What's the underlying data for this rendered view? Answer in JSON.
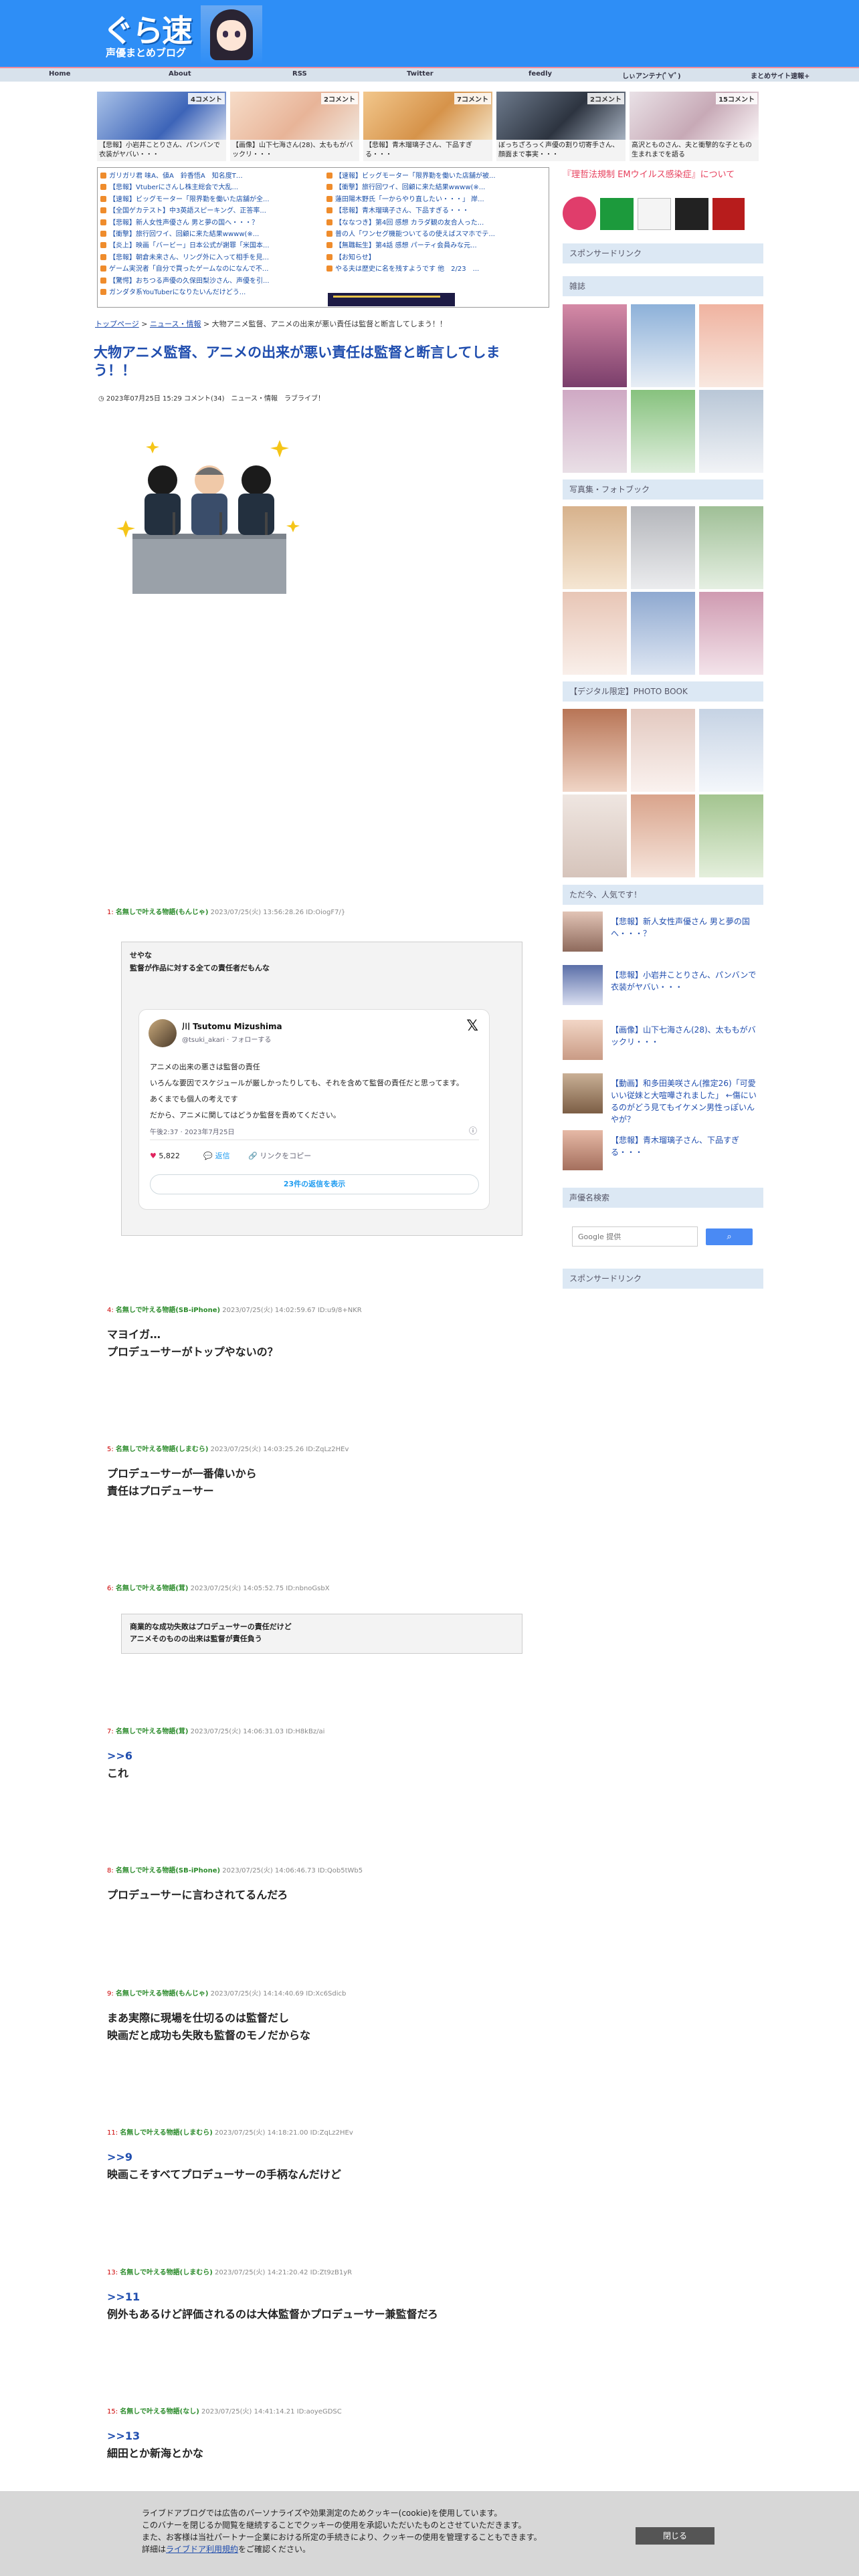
{
  "site": {
    "logo_main": "ぐら速",
    "logo_sub": "声優まとめブログ"
  },
  "nav": [
    "Home",
    "About",
    "RSS",
    "Twitter",
    "feedly",
    "しぃアンテナ(ﾟ∀ﾟ)",
    "まとめサイト速報+"
  ],
  "feature_cards": [
    {
      "comments": "4コメント",
      "caption": "【悲報】小岩井ことりさん、パンバンで衣装がヤバい・・・"
    },
    {
      "comments": "2コメント",
      "caption": "【画像】山下七海さん(28)、太ももがバックリ・・・"
    },
    {
      "comments": "7コメント",
      "caption": "【悲報】青木瑠璃子さん、下品すぎる・・・"
    },
    {
      "comments": "2コメント",
      "caption": "ぼっちざろっく声優の割り切寄手さん、顔面まで事実・・・"
    },
    {
      "comments": "15コメント",
      "caption": "高沢とものさん、夫と衝撃的な子ともの生まれまでを語る"
    }
  ],
  "links_left": [
    "ガリガリ君 味A、値A　鈴香悟A　知名度T…",
    "【悲報】Vtuberにさんし株主総会で大乱...",
    "【速報】ビッグモーター「限界勤を働いた店舗が全...",
    "【全国ゲカテスト】中3英語スピーキング、正答率...",
    "【悲報】新人女性声優さん 男と夢の国へ・・・？",
    "【衝撃】旅行回ワイ、回顧に来た結果wwww(※...",
    "【炎上】映画「バービー」日本公式が謝罪「米国本...",
    "【悲報】朝倉未来さん、リング外に入って相手を見...",
    "ゲーム実況者「自分で買ったゲームなのになんで不...",
    "【驚愕】おちつる声優の久保田梨沙さん、声優を引...",
    "ガンダタ系YouTuberになりたいんだけどう..."
  ],
  "links_right": [
    "【速報】ビッグモーター「限界勤を働いた店舗が被...",
    "【衝撃】旅行回ワイ、回顧に来た結果wwww(※...",
    "蓮田陽木野氏「一からやり直したい・・・」 岸...",
    "【悲報】青木瑠璃子さん、下品すぎる・・・",
    "【ななつき】第4回 感想 カラダ観の友合人った...",
    "普の人「ワンセグ機能ついてるの使えばスマホでテ...",
    "【無職転生】第4話 感想 パーティ会員みな元...",
    "【お知らせ】",
    "やる夫は歴史に名を残すようです 他　2/23　..."
  ],
  "breadcrumb": {
    "top": "トップページ",
    "cat": "ニュース・情報",
    "current": "> 大物アニメ監督、アニメの出来が悪い責任は監督と断言してしまう！！"
  },
  "article": {
    "title": "大物アニメ監督、アニメの出来が悪い責任は監督と断言してしまう！！",
    "meta": "2023年07月25日 15:29 コメント(34)　ニュース・情報　ラブライブ！"
  },
  "posts": [
    {
      "num": "1:",
      "name": "名無しで叶える物語(もんじゃ)",
      "info": "2023/07/25(火) 13:56:28.26 ID:OiogF7/}",
      "quote": [
        "せやな",
        "監督が作品に対する全ての責任者だもんな"
      ]
    },
    {
      "num": "4:",
      "name": "名無しで叶える物語(SB-iPhone)",
      "info": "2023/07/25(火) 14:02:59.67 ID:u9/8+NKR",
      "lines": [
        "マヨイガ…",
        "プロデューサーがトップやないの？"
      ]
    },
    {
      "num": "5:",
      "name": "名無しで叶える物語(しまむら)",
      "info": "2023/07/25(火) 14:03:25.26 ID:ZqLz2HEv",
      "lines": [
        "プロデューサーが一番偉いから",
        "責任はプロデューサー"
      ]
    },
    {
      "num": "6:",
      "name": "名無しで叶える物語(茸)",
      "info": "2023/07/25(火) 14:05:52.75 ID:nbnoGsbX",
      "quote": [
        "商業的な成功失敗はプロデューサーの責任だけど",
        "アニメそのものの出来は監督が責任負う"
      ]
    },
    {
      "num": "7:",
      "name": "名無しで叶える物語(茸)",
      "info": "2023/07/25(火) 14:06:31.03 ID:H8kBz/ai",
      "anchor": ">>6",
      "lines": [
        "これ"
      ]
    },
    {
      "num": "8:",
      "name": "名無しで叶える物語(SB-iPhone)",
      "info": "2023/07/25(火) 14:06:46.73 ID:Qob5tWb5",
      "lines": [
        "プロデューサーに言わされてるんだろ"
      ]
    },
    {
      "num": "9:",
      "name": "名無しで叶える物語(もんじゃ)",
      "info": "2023/07/25(火) 14:14:40.69 ID:Xc6Sdicb",
      "lines": [
        "まあ実際に現場を仕切るのは監督だし",
        "映画だと成功も失敗も監督のモノだからな"
      ]
    },
    {
      "num": "11:",
      "name": "名無しで叶える物語(しまむら)",
      "info": "2023/07/25(火) 14:18:21.00 ID:ZqLz2HEv",
      "anchor": ">>9",
      "lines": [
        "映画こそすべてプロデューサーの手柄なんだけど"
      ]
    },
    {
      "num": "13:",
      "name": "名無しで叶える物語(しまむら)",
      "info": "2023/07/25(火) 14:21:20.42 ID:Zt9zB1yR",
      "anchor": ">>11",
      "lines": [
        "例外もあるけど評価されるのは大体監督かプロデューサー兼監督だろ"
      ]
    },
    {
      "num": "15:",
      "name": "名無しで叶える物語(なし)",
      "info": "2023/07/25(火) 14:41:14.21 ID:aoyeGDSC",
      "anchor": ">>13",
      "lines": [
        "細田とか新海とかな"
      ]
    }
  ],
  "tweet": {
    "name": "川 Tsutomu Mizushima",
    "handle": "@tsuki_akari · フォローする",
    "lines": [
      "アニメの出来の悪さは監督の責任",
      "いろんな要因でスケジュールが厳しかったりしても、それを含めて監督の責任だと思ってます。",
      "あくまでも個人の考えです",
      "だから、アニメに関してはどうか監督を責めてください。"
    ],
    "time": "午後2:37 · 2023年7月25日",
    "likes": "5,822",
    "reply": "返信",
    "copy": "リンクをコピー",
    "more": "23件の返信を表示"
  },
  "sidebar": {
    "banner": "『理哲法規制 ​​EMウイルス感染症』について",
    "h_sponsor": "スポンサードリンク",
    "h_magazine": "雑誌",
    "h_photo": "写真集・フォトブック",
    "h_digital": "【デジタル限定】PHOTO BOOK",
    "h_popular": "ただ今、人気です！",
    "popular": [
      "【悲報】新人女性声優さん 男と夢の国へ・・・？",
      "【悲報】小岩井ことりさん、パンバンで衣装がヤバい・・・",
      "【画像】山下七海さん(28)、太ももがバックリ・・・",
      "【動画】和多田美咲さん(推定26)「可愛いい従妹と大喧嘩されました」 ←傷にいるのがどう見てもイケメン男性っぽいんやが？",
      "【悲報】青木瑠璃子さん、下品すぎる・・・"
    ],
    "h_search": "声優名検索",
    "search_placeholder": "Google 提供",
    "h_sponsor2": "スポンサードリンク"
  },
  "cookie": {
    "line1": "ライブドアブログでは広告のパーソナライズや効果測定のためクッキー(cookie)を使用しています。",
    "line2": "このバナーを閉じるか閲覧を継続することでクッキーの使用を承認いただいたものとさせていただきます。",
    "line3": "また、お客様は当社パートナー企業における所定の手続きにより、クッキーの使用を管理することもできます。",
    "line4_pre": "詳細は",
    "line4_link": "ライブドア利用規約",
    "line4_post": "をご確認ください。",
    "close": "閉じる"
  }
}
